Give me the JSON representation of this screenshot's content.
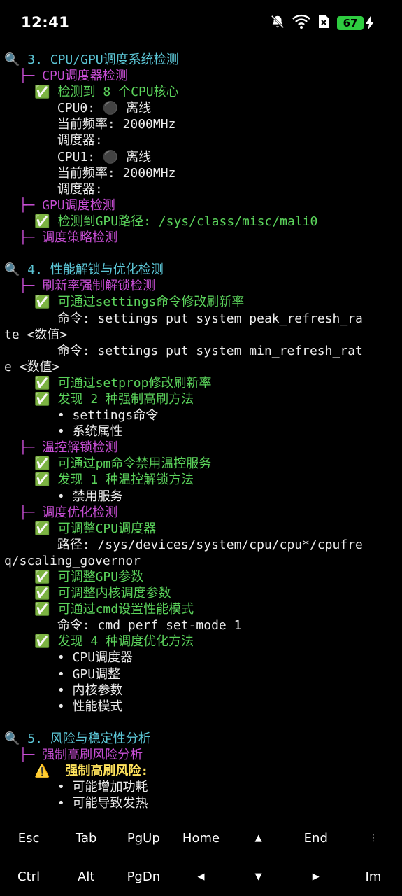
{
  "status_bar": {
    "time": "12:41",
    "battery_level": "67",
    "icons": [
      "bell-off-icon",
      "wifi-icon",
      "sim-off-icon",
      "battery-icon",
      "charging-bolt-icon"
    ]
  },
  "terminal": {
    "lines": [
      {
        "text": "🔍 3. CPU/GPU调度系统检测",
        "style": "head"
      },
      {
        "text": "  ├─ CPU调度器检测",
        "style": "sub"
      },
      {
        "text": "    ✅ 检测到 8 个CPU核心",
        "style": "ok"
      },
      {
        "text": "       CPU0: ⚫ 离线",
        "style": "txt"
      },
      {
        "text": "       当前频率: 2000MHz",
        "style": "txt"
      },
      {
        "text": "       调度器:",
        "style": "txt"
      },
      {
        "text": "       CPU1: ⚫ 离线",
        "style": "txt"
      },
      {
        "text": "       当前频率: 2000MHz",
        "style": "txt"
      },
      {
        "text": "       调度器:",
        "style": "txt"
      },
      {
        "text": "  ├─ GPU调度检测",
        "style": "sub"
      },
      {
        "text": "    ✅ 检测到GPU路径: /sys/class/misc/mali0",
        "style": "ok"
      },
      {
        "text": "  ├─ 调度策略检测",
        "style": "sub"
      },
      {
        "text": "",
        "style": "txt"
      },
      {
        "text": "🔍 4. 性能解锁与优化检测",
        "style": "head"
      },
      {
        "text": "  ├─ 刷新率强制解锁检测",
        "style": "sub"
      },
      {
        "text": "    ✅ 可通过settings命令修改刷新率",
        "style": "ok"
      },
      {
        "text": "       命令: settings put system peak_refresh_ra",
        "style": "txt"
      },
      {
        "text": "te <数值>",
        "style": "txt"
      },
      {
        "text": "       命令: settings put system min_refresh_rat",
        "style": "txt"
      },
      {
        "text": "e <数值>",
        "style": "txt"
      },
      {
        "text": "    ✅ 可通过setprop修改刷新率",
        "style": "ok"
      },
      {
        "text": "    ✅ 发现 2 种强制高刷方法",
        "style": "ok"
      },
      {
        "text": "       • settings命令",
        "style": "txt"
      },
      {
        "text": "       • 系统属性",
        "style": "txt"
      },
      {
        "text": "  ├─ 温控解锁检测",
        "style": "sub"
      },
      {
        "text": "    ✅ 可通过pm命令禁用温控服务",
        "style": "ok"
      },
      {
        "text": "    ✅ 发现 1 种温控解锁方法",
        "style": "ok"
      },
      {
        "text": "       • 禁用服务",
        "style": "txt"
      },
      {
        "text": "  ├─ 调度优化检测",
        "style": "sub"
      },
      {
        "text": "    ✅ 可调整CPU调度器",
        "style": "ok"
      },
      {
        "text": "       路径: /sys/devices/system/cpu/cpu*/cpufre",
        "style": "txt"
      },
      {
        "text": "q/scaling_governor",
        "style": "txt"
      },
      {
        "text": "    ✅ 可调整GPU参数",
        "style": "ok"
      },
      {
        "text": "    ✅ 可调整内核调度参数",
        "style": "ok"
      },
      {
        "text": "    ✅ 可通过cmd设置性能模式",
        "style": "ok"
      },
      {
        "text": "       命令: cmd perf set-mode 1",
        "style": "txt"
      },
      {
        "text": "    ✅ 发现 4 种调度优化方法",
        "style": "ok"
      },
      {
        "text": "       • CPU调度器",
        "style": "txt"
      },
      {
        "text": "       • GPU调整",
        "style": "txt"
      },
      {
        "text": "       • 内核参数",
        "style": "txt"
      },
      {
        "text": "       • 性能模式",
        "style": "txt"
      },
      {
        "text": "",
        "style": "txt"
      },
      {
        "text": "🔍 5. 风险与稳定性分析",
        "style": "head"
      },
      {
        "text": "  ├─ 强制高刷风险分析",
        "style": "sub"
      },
      {
        "text": "    ⚠️  强制高刷风险:",
        "style": "warn"
      },
      {
        "text": "       • 可能增加功耗",
        "style": "txt"
      },
      {
        "text": "       • 可能导致发热",
        "style": "txt"
      }
    ]
  },
  "extra_keys": {
    "row1": [
      "Esc",
      "Tab",
      "PgUp",
      "Home",
      "▲",
      "End",
      "⋮"
    ],
    "row2": [
      "Ctrl",
      "Alt",
      "PgDn",
      "◀",
      "▼",
      "▶",
      "Im"
    ]
  }
}
